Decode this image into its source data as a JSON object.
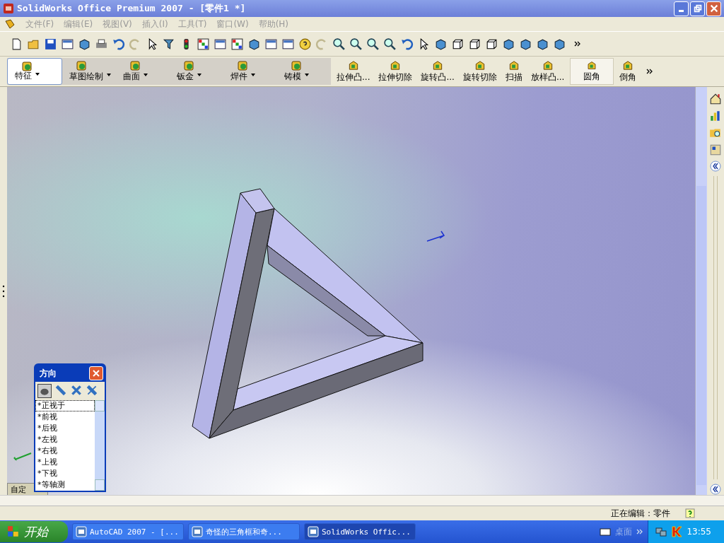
{
  "window": {
    "title": "SolidWorks Office Premium 2007 - [零件1 *]"
  },
  "menu": [
    "文件(F)",
    "编辑(E)",
    "视图(V)",
    "插入(I)",
    "工具(T)",
    "窗口(W)",
    "帮助(H)"
  ],
  "command_tabs": [
    {
      "label": "特征",
      "selected": true
    },
    {
      "label": "草图绘制",
      "selected": false
    },
    {
      "label": "曲面",
      "selected": false
    },
    {
      "label": "钣金",
      "selected": false
    },
    {
      "label": "焊件",
      "selected": false
    },
    {
      "label": "铸模",
      "selected": false
    }
  ],
  "tools": [
    {
      "label": "拉伸凸...",
      "pressed": false
    },
    {
      "label": "拉伸切除",
      "pressed": false
    },
    {
      "label": "旋转凸...",
      "pressed": false
    },
    {
      "label": "旋转切除",
      "pressed": false
    },
    {
      "label": "扫描",
      "pressed": false
    },
    {
      "label": "放样凸...",
      "pressed": false
    },
    {
      "label": "圆角",
      "pressed": true
    },
    {
      "label": "倒角",
      "pressed": false
    }
  ],
  "custom_tab": "自定",
  "orientation_dialog": {
    "title": "方向",
    "views": [
      {
        "label": "*正视于",
        "selected": true
      },
      {
        "label": "*前视",
        "selected": false
      },
      {
        "label": "*后视",
        "selected": false
      },
      {
        "label": "*左视",
        "selected": false
      },
      {
        "label": "*右视",
        "selected": false
      },
      {
        "label": "*上视",
        "selected": false
      },
      {
        "label": "*下视",
        "selected": false
      },
      {
        "label": "*等轴测",
        "selected": false
      }
    ]
  },
  "status_bar": {
    "text": "正在编辑：零件"
  },
  "taskbar": {
    "start": "开始",
    "tasks": [
      {
        "label": "AutoCAD 2007 - [...",
        "selected": false
      },
      {
        "label": "奇怪的三角框和奇...",
        "selected": false
      },
      {
        "label": "SolidWorks Offic...",
        "selected": true
      }
    ],
    "desktop": "桌面",
    "clock": "13:55"
  }
}
